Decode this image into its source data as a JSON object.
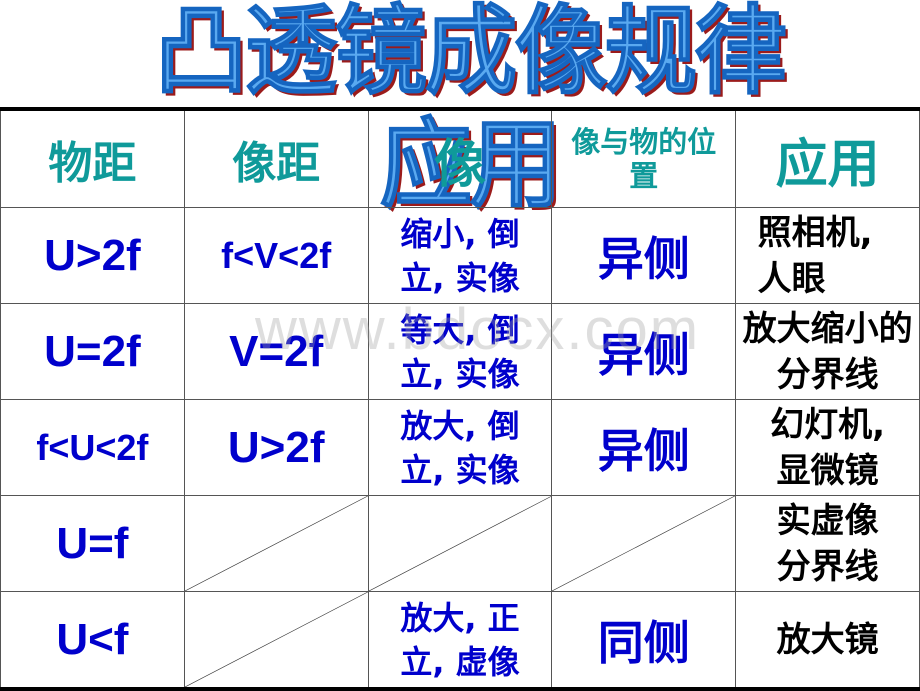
{
  "title": "凸透镜成像规律应用",
  "watermark": "www.bdocx.com",
  "colors": {
    "header": "#0f9a9a",
    "formula": "#0000cc",
    "application": "#000000",
    "title_fill": "#5aa9f0",
    "title_shadow": "#9b1b1b"
  },
  "table": {
    "headers": [
      "物距",
      "像距",
      "像",
      "像与物的位置",
      "应用"
    ],
    "rows": [
      {
        "object_distance": "U>2f",
        "image_distance": "f<V<2f",
        "image": "缩小, 倒立, 实像",
        "position": "异侧",
        "application": "照相机, 人眼"
      },
      {
        "object_distance": "U=2f",
        "image_distance": "V=2f",
        "image": "等大, 倒立, 实像",
        "position": "异侧",
        "application": "放大缩小的分界线"
      },
      {
        "object_distance": "f<U<2f",
        "image_distance": "U>2f",
        "image": "放大, 倒立, 实像",
        "position": "异侧",
        "application": "幻灯机, 显微镜"
      },
      {
        "object_distance": "U=f",
        "image_distance": "",
        "image": "",
        "position": "",
        "application": "实虚像分界线"
      },
      {
        "object_distance": "U<f",
        "image_distance": "",
        "image": "放大, 正立, 虚像",
        "position": "同侧",
        "application": "放大镜"
      }
    ]
  }
}
